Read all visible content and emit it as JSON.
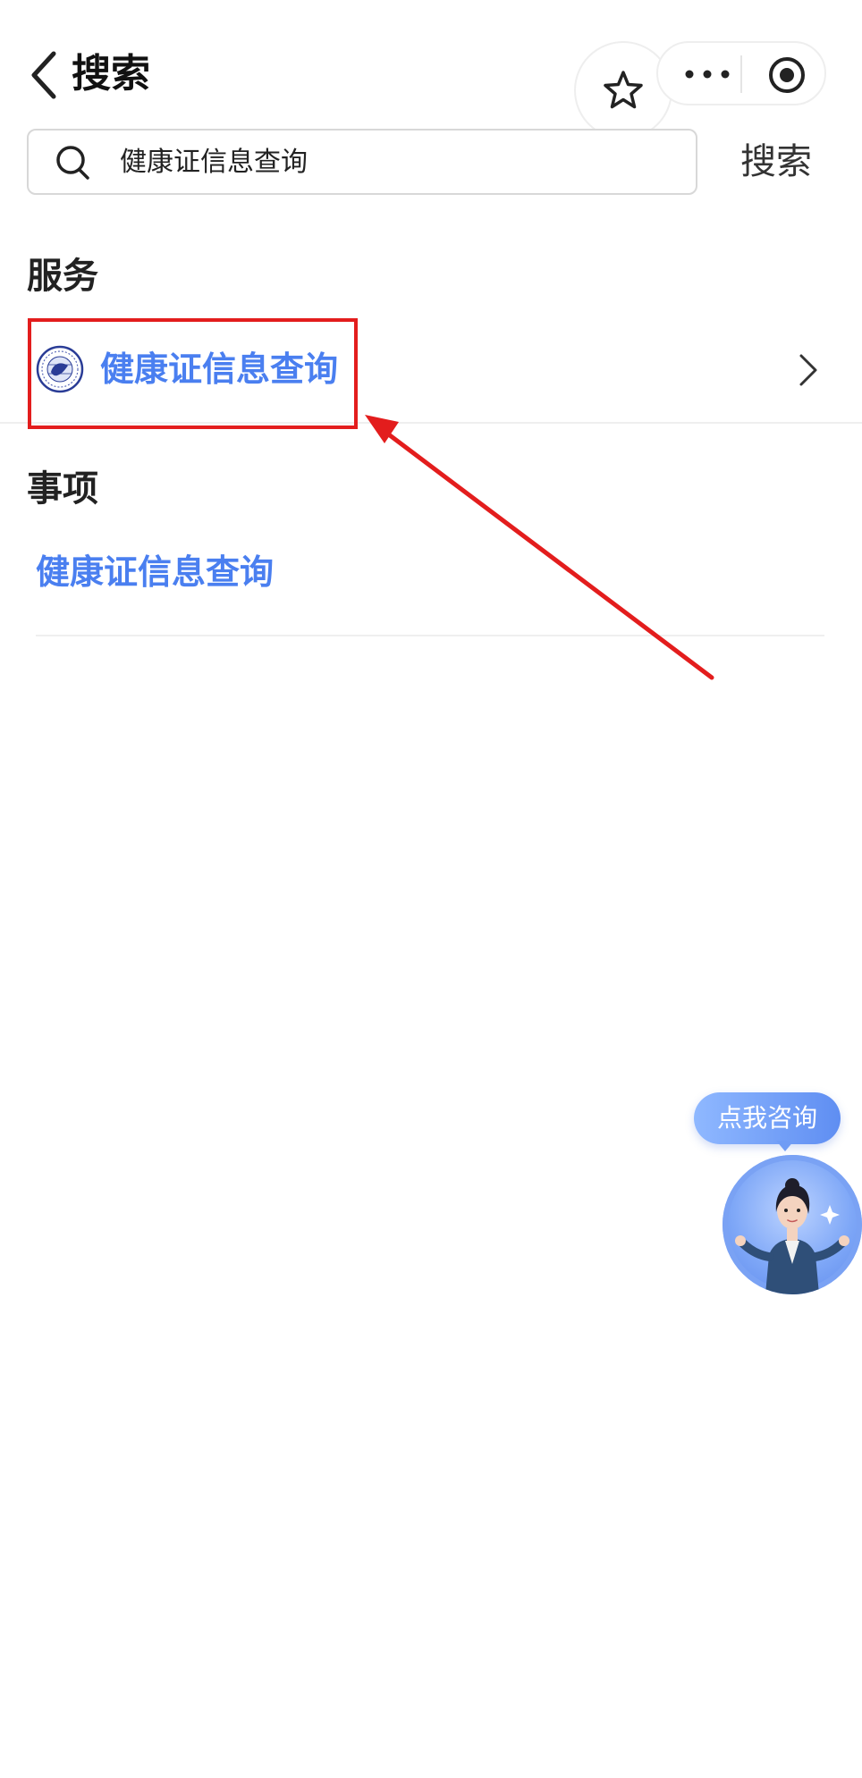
{
  "header": {
    "title": "搜索",
    "icons": [
      "chevron-left-icon",
      "star-icon",
      "more-icon",
      "target-icon"
    ]
  },
  "search": {
    "value": "健康证信息查询",
    "button_label": "搜索",
    "icon": "search-icon"
  },
  "services": {
    "section_title": "服务",
    "items": [
      {
        "label": "健康证信息查询",
        "icon": "seal-icon"
      }
    ]
  },
  "matters": {
    "section_title": "事项",
    "items": [
      {
        "label": "健康证信息查询"
      }
    ]
  },
  "assistant": {
    "bubble_label": "点我咨询"
  },
  "colors": {
    "link_blue": "#4a7ff0",
    "annotation_red": "#e31d1d",
    "bubble_gradient_start": "#8fb8ff",
    "bubble_gradient_end": "#5f8ef2"
  }
}
